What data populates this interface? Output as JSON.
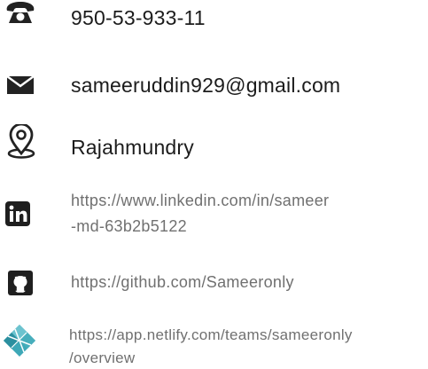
{
  "contact": {
    "phone": "950-53-933-11",
    "email": "sameeruddin929@gmail.com",
    "location": "Rajahmundry"
  },
  "links": {
    "linkedin_line1": "https://www.linkedin.com/in/sameer",
    "linkedin_line2": "-md-63b2b5122",
    "github": "https://github.com/Sameeronly",
    "netlify_line1": "https://app.netlify.com/teams/sameeronly",
    "netlify_line2": "/overview"
  },
  "icons": {
    "phone": "phone-icon",
    "email": "envelope-icon",
    "location": "map-pin-icon",
    "linkedin": "linkedin-icon",
    "github": "github-icon",
    "netlify": "netlify-icon"
  },
  "colors": {
    "icon_dark": "#222222",
    "icon_grey": "#7a7a7a",
    "netlify_teal": "#3ea8b7",
    "text_dark": "#1c1c1c",
    "text_link": "#707070"
  }
}
